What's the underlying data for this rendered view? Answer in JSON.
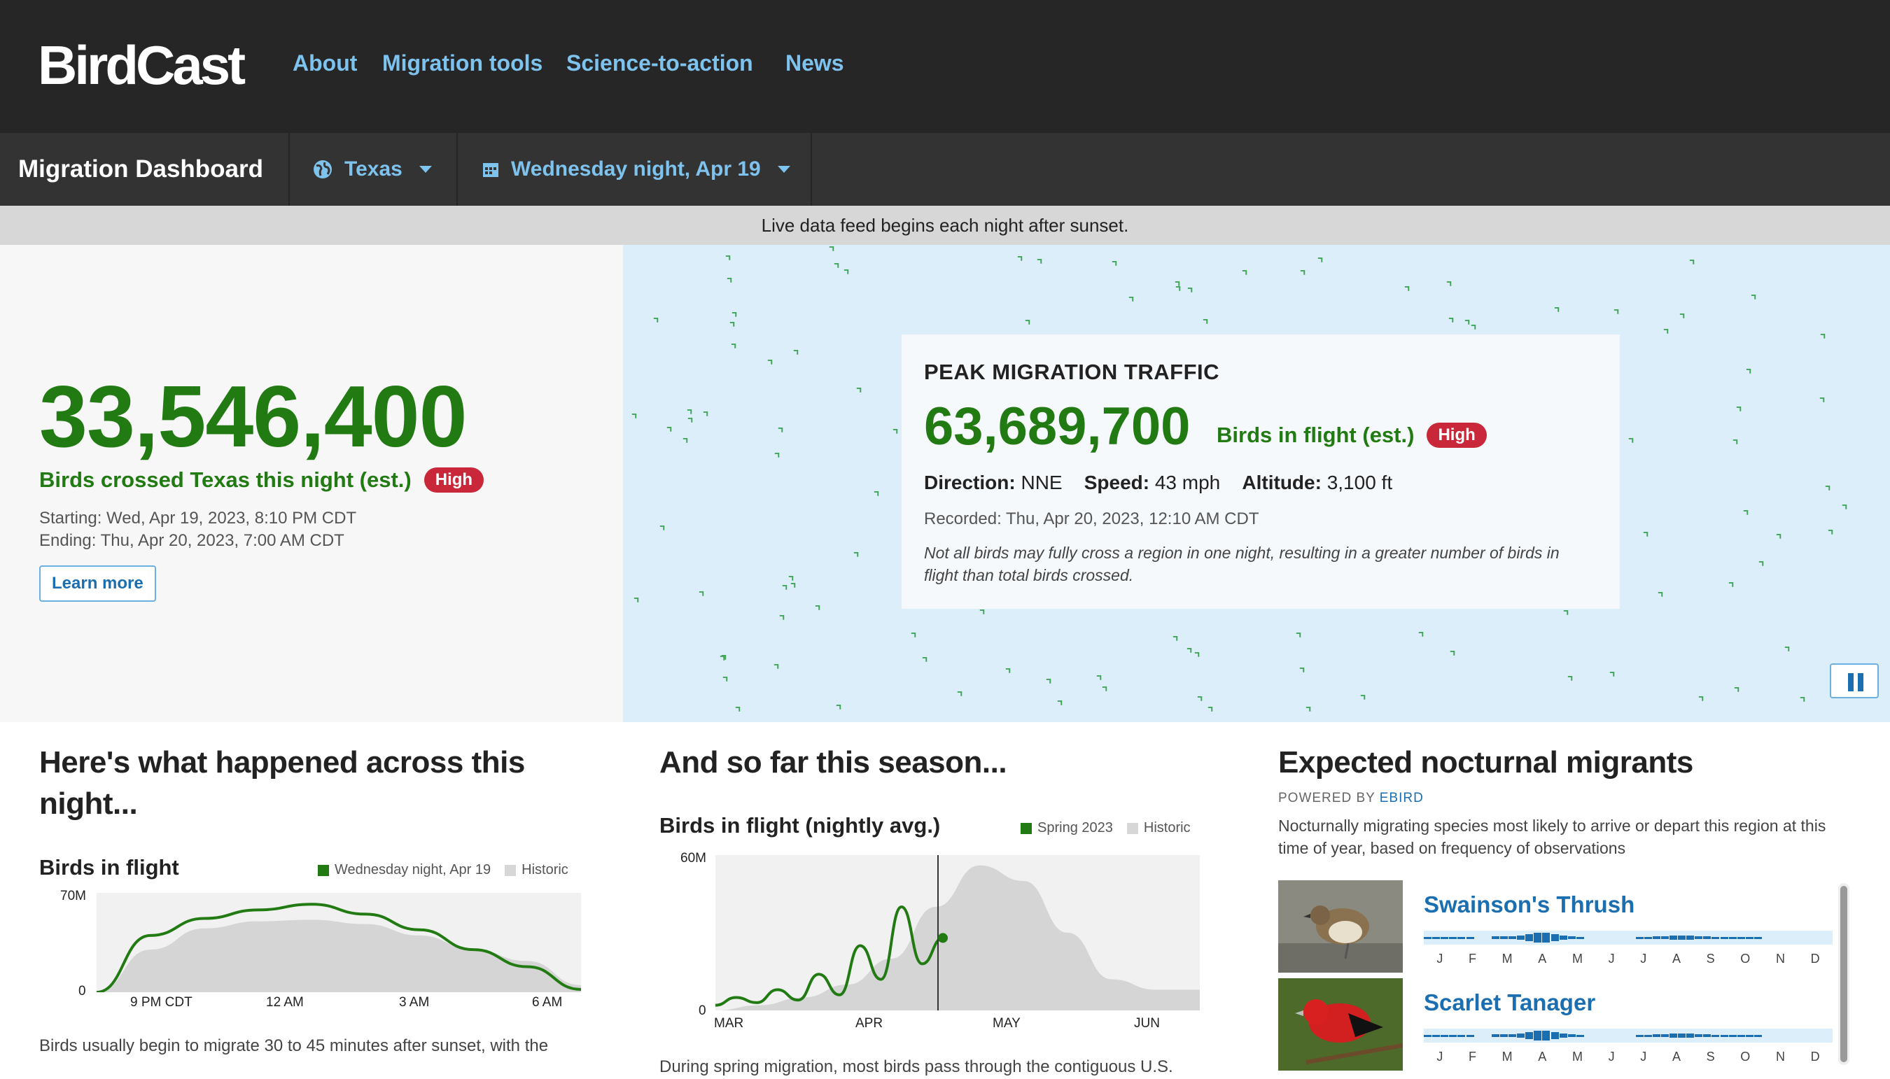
{
  "header": {
    "logo": "BirdCast",
    "nav": [
      "About",
      "Migration tools",
      "Science-to-action",
      "News"
    ]
  },
  "subbar": {
    "title": "Migration Dashboard",
    "region": "Texas",
    "date": "Wednesday night, Apr 19"
  },
  "banner": "Live data feed begins each night after sunset.",
  "summary": {
    "total": "33,546,400",
    "label": "Birds crossed Texas this night (est.)",
    "level": "High",
    "start": "Starting: Wed, Apr 19, 2023, 8:10 PM CDT",
    "end": "Ending: Thu, Apr 20, 2023, 7:00 AM CDT",
    "learn_more": "Learn more"
  },
  "peak": {
    "title": "PEAK MIGRATION TRAFFIC",
    "count": "63,689,700",
    "label": "Birds in flight (est.)",
    "level": "High",
    "direction_label": "Direction:",
    "direction": "NNE",
    "speed_label": "Speed:",
    "speed": "43 mph",
    "altitude_label": "Altitude:",
    "altitude": "3,100 ft",
    "recorded": "Recorded: Thu, Apr 20, 2023, 12:10 AM CDT",
    "note": "Not all birds may fully cross a region in one night, resulting in a greater number of birds in flight than total birds crossed."
  },
  "night": {
    "heading": "Here's what happened across this night...",
    "chart_title": "Birds in flight",
    "legend_a": "Wednesday night, Apr 19",
    "legend_b": "Historic",
    "y_top": "70M",
    "y_bottom": "0",
    "x_ticks": [
      "9 PM CDT",
      "12 AM",
      "3 AM",
      "6 AM"
    ],
    "text": "Birds usually begin to migrate 30 to 45 minutes after sunset, with the"
  },
  "season": {
    "heading": "And so far this season...",
    "chart_title": "Birds in flight (nightly avg.)",
    "legend_a": "Spring 2023",
    "legend_b": "Historic",
    "y_top": "60M",
    "y_bottom": "0",
    "x_ticks": [
      "MAR",
      "APR",
      "MAY",
      "JUN"
    ],
    "text": "During spring migration, most birds pass through the contiguous U.S."
  },
  "migrants": {
    "heading": "Expected nocturnal migrants",
    "powered_prefix": "POWERED BY",
    "powered_brand": "EBIRD",
    "description": "Nocturnally migrating species most likely to arrive or depart this region at this time of year, based on frequency of observations",
    "species": [
      {
        "name": "Swainson's Thrush"
      },
      {
        "name": "Scarlet Tanager"
      }
    ],
    "months": [
      "J",
      "F",
      "M",
      "A",
      "M",
      "J",
      "J",
      "A",
      "S",
      "O",
      "N",
      "D"
    ]
  },
  "chart_data": [
    {
      "type": "area",
      "title": "Birds in flight",
      "xlabel": "",
      "ylabel": "",
      "x": [
        "9 PM CDT",
        "12 AM",
        "3 AM",
        "6 AM"
      ],
      "ylim": [
        0,
        70000000
      ],
      "series": [
        {
          "name": "Wednesday night, Apr 19",
          "values": [
            0,
            40000000,
            52000000,
            58000000,
            62000000,
            55000000,
            44000000,
            30000000,
            18000000,
            2000000
          ]
        },
        {
          "name": "Historic",
          "values": [
            0,
            30000000,
            45000000,
            50000000,
            51000000,
            48000000,
            40000000,
            30000000,
            22000000,
            5000000
          ]
        }
      ]
    },
    {
      "type": "line",
      "title": "Birds in flight (nightly avg.)",
      "xlabel": "",
      "ylabel": "",
      "x": [
        "MAR",
        "APR",
        "MAY",
        "JUN"
      ],
      "ylim": [
        0,
        60000000
      ],
      "series": [
        {
          "name": "Spring 2023",
          "values": [
            2000000,
            5000000,
            3000000,
            8000000,
            4000000,
            14000000,
            6000000,
            25000000,
            12000000,
            40000000,
            18000000,
            28000000
          ]
        },
        {
          "name": "Historic",
          "values": [
            0,
            2000000,
            5000000,
            10000000,
            20000000,
            40000000,
            56000000,
            50000000,
            30000000,
            12000000,
            8000000,
            8000000
          ]
        }
      ]
    }
  ],
  "colors": {
    "accent_green": "#217a12",
    "nav_blue": "#7ec2ee",
    "badge_red": "#c8283a",
    "link_blue": "#1b6fb0"
  }
}
